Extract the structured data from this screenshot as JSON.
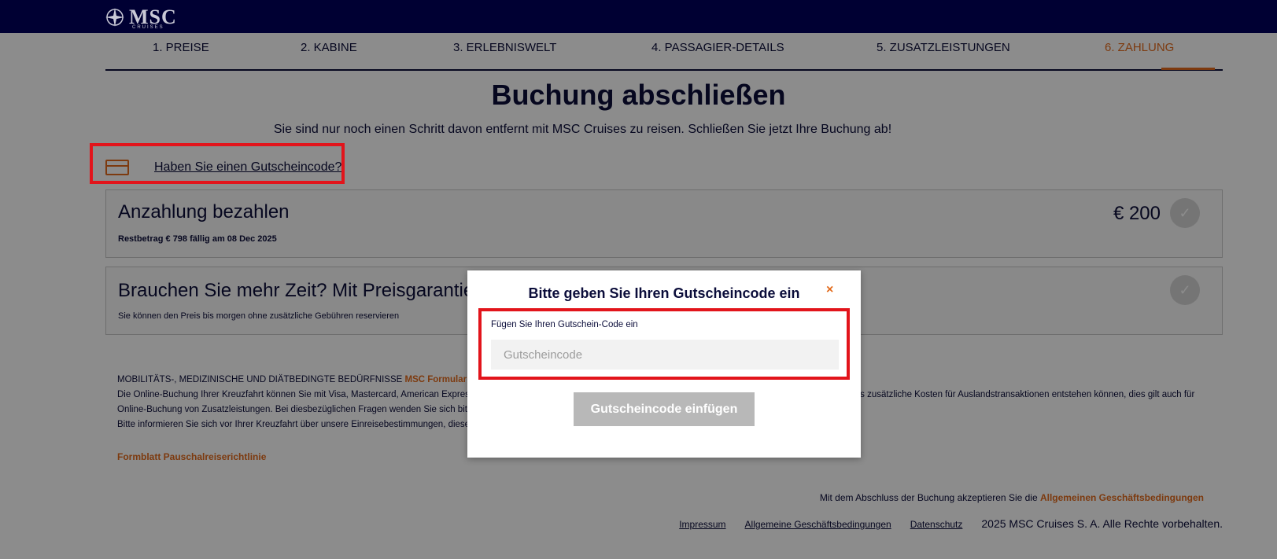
{
  "brand": {
    "logo_text": "MSC",
    "logo_sub": "CRUISES"
  },
  "steps": [
    {
      "label": "1. PREISE"
    },
    {
      "label": "2. KABINE"
    },
    {
      "label": "3. ERLEBNISWELT"
    },
    {
      "label": "4. PASSAGIER-DETAILS"
    },
    {
      "label": "5. ZUSATZLEISTUNGEN"
    },
    {
      "label": "6. ZAHLUNG",
      "active": true
    }
  ],
  "page": {
    "title": "Buchung abschließen",
    "subtitle": "Sie sind nur noch einen Schritt davon entfernt mit MSC Cruises zu reisen. Schließen Sie jetzt Ihre Buchung ab!"
  },
  "voucher": {
    "link": "Haben Sie einen Gutscheincode?"
  },
  "deposit": {
    "title": "Anzahlung bezahlen",
    "price": "€ 200",
    "remaining": "Restbetrag  € 798  fällig am 08 Dec 2025"
  },
  "price_guarantee": {
    "title": "Brauchen Sie mehr Zeit? Mit Preisgarantie re",
    "sub": "Sie können den Preis bis morgen ohne zusätzliche Gebühren reservieren"
  },
  "info": {
    "needs_prefix": "MOBILITÄTS-, MEDIZINISCHE UND DIÄTBEDINGTE BEDÜRFNISSE ",
    "needs_link": "MSC Formular Be",
    "line1_left": "Die Online-Buchung Ihrer Kreuzfahrt können Sie mit Visa, Mastercard, American Expres",
    "line1_right": "ass zusätzliche Kosten für Auslandstransaktionen entstehen können, dies gilt auch für",
    "line2": "Online-Buchung von Zusatzleistungen. Bei diesbezüglichen Fragen wenden Sie sich bitt",
    "line3": "Bitte informieren Sie sich vor Ihrer Kreuzfahrt über unsere Einreisebestimmungen, diese f"
  },
  "form_link": "Formblatt Pauschalreiserichtlinie",
  "terms": {
    "prefix": "Mit dem Abschluss der Buchung akzeptieren Sie die ",
    "link": "Allgemeinen Geschäftsbedingungen"
  },
  "footer": {
    "links": [
      "Impressum",
      "Allgemeine Geschäftsbedingungen",
      "Datenschutz"
    ],
    "copyright": "2025 MSC Cruises S. A. Alle Rechte vorbehalten."
  },
  "modal": {
    "title": "Bitte geben Sie Ihren Gutscheincode ein",
    "close": "×",
    "field_label": "Fügen Sie Ihren Gutschein-Code ein",
    "placeholder": "Gutscheincode",
    "value": "",
    "button": "Gutscheincode einfügen"
  },
  "colors": {
    "navy": "#000033",
    "accent": "#e36b1c",
    "annotation": "#e2141b"
  }
}
